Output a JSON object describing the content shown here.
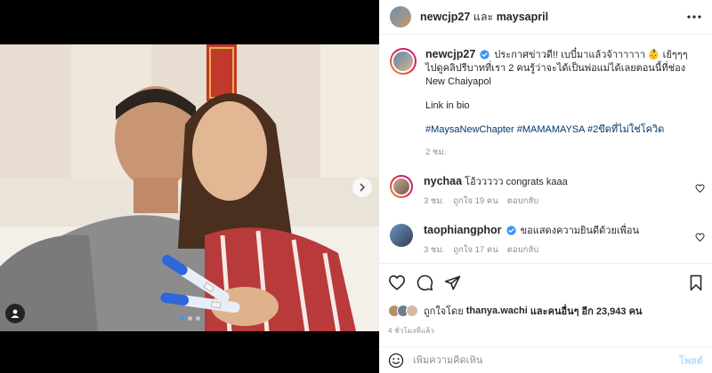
{
  "header": {
    "user1": "newcjp27",
    "and_word": "และ",
    "user2": "maysapril",
    "more_icon": "more-horizontal-icon"
  },
  "caption": {
    "username": "newcjp27",
    "text": "ประกาศข่าวดี!! เบบี๋มาแล้วจ้าาาาาา 👶 เย้ๆๆๆ ไปดูคลิปรีบาทที่เรา 2 คนรู้ว่าจะได้เป็นพ่อแม่ได้เลยตอนนี้ที่ช่อง New Chaiyapol",
    "link_line": "Link in bio",
    "hashtags": "#MaysaNewChapter #MAMAMAYSA #2ขีดที่ไม่ใช่โควิด",
    "time": "2 ชม."
  },
  "comments": [
    {
      "username": "nychaa",
      "text": "โอ้ววววว congrats kaaa",
      "time": "3 ชม.",
      "likes": "ถูกใจ 19 คน",
      "reply": "ตอบกลับ"
    },
    {
      "username": "taophiangphor",
      "text": "ขอแสดงความยินดีด้วยเพื่อน",
      "time": "3 ชม.",
      "likes": "ถูกใจ 17 คน",
      "reply": "ตอบกลับ"
    }
  ],
  "likes": {
    "prefix": "ถูกใจโดย",
    "user": "thanya.wachi",
    "and_others": "และคนอื่นๆ อีก 23,943 คน"
  },
  "post_time": "4 ชั่วโมงที่แล้ว",
  "add_comment": {
    "placeholder": "เพิ่มความคิดเห็น",
    "post_label": "โพสต์"
  },
  "media": {
    "slides": 3,
    "active_slide": 1
  },
  "colors": {
    "link": "#00376b",
    "verified": "#3897f0",
    "post_disabled": "#b2dffc"
  }
}
